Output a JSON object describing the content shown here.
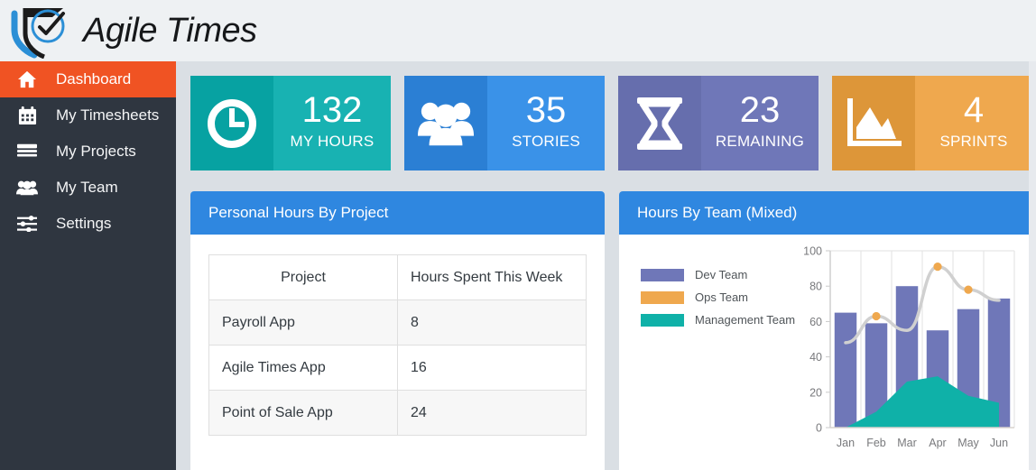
{
  "header": {
    "brand": "Agile Times",
    "logo_icon": "shield-check-clock-logo"
  },
  "sidebar": {
    "items": [
      {
        "label": "Dashboard",
        "icon": "home-icon",
        "active": true
      },
      {
        "label": "My Timesheets",
        "icon": "calendar-icon",
        "active": false
      },
      {
        "label": "My Projects",
        "icon": "list-icon",
        "active": false
      },
      {
        "label": "My Team",
        "icon": "users-icon",
        "active": false
      },
      {
        "label": "Settings",
        "icon": "sliders-icon",
        "active": false
      }
    ]
  },
  "cards": [
    {
      "value": "132",
      "label": "MY HOURS",
      "icon": "clock-icon",
      "color": "#18b2b2",
      "icon_bg": "#07a2a2"
    },
    {
      "value": "35",
      "label": "STORIES",
      "icon": "users-icon",
      "color": "#3a92e8",
      "icon_bg": "#2b7fd4"
    },
    {
      "value": "23",
      "label": "REMAINING",
      "icon": "hourglass-icon",
      "color": "#6f77b8",
      "icon_bg": "#666ead"
    },
    {
      "value": "4",
      "label": "SPRINTS",
      "icon": "area-chart-icon",
      "color": "#efa84e",
      "icon_bg": "#dd9639"
    }
  ],
  "table_panel": {
    "title": "Personal Hours By Project",
    "columns": [
      "Project",
      "Hours Spent This Week"
    ],
    "rows": [
      {
        "project": "Payroll App",
        "hours": "8"
      },
      {
        "project": "Agile Times App",
        "hours": "16"
      },
      {
        "project": "Point of Sale App",
        "hours": "24"
      }
    ]
  },
  "chart_panel": {
    "title": "Hours By Team (Mixed)"
  },
  "chart_data": {
    "type": "bar",
    "title": "Hours By Team (Mixed)",
    "categories": [
      "Jan",
      "Feb",
      "Mar",
      "Apr",
      "May",
      "Jun"
    ],
    "series": [
      {
        "name": "Dev Team",
        "type": "bar",
        "color": "#6f77b8",
        "values": [
          65,
          59,
          80,
          55,
          67,
          73
        ]
      },
      {
        "name": "Ops Team",
        "type": "line",
        "color": "#efa84e",
        "values": [
          48,
          63,
          55,
          91,
          78,
          72
        ]
      },
      {
        "name": "Management Team",
        "type": "area",
        "color": "#0fb1a8",
        "values": [
          0,
          9,
          26,
          29,
          18,
          14
        ]
      }
    ],
    "xlabel": "",
    "ylabel": "",
    "ylim": [
      0,
      100
    ],
    "yticks": [
      0,
      20,
      40,
      60,
      80,
      100
    ],
    "grid": true,
    "legend_position": "left"
  }
}
